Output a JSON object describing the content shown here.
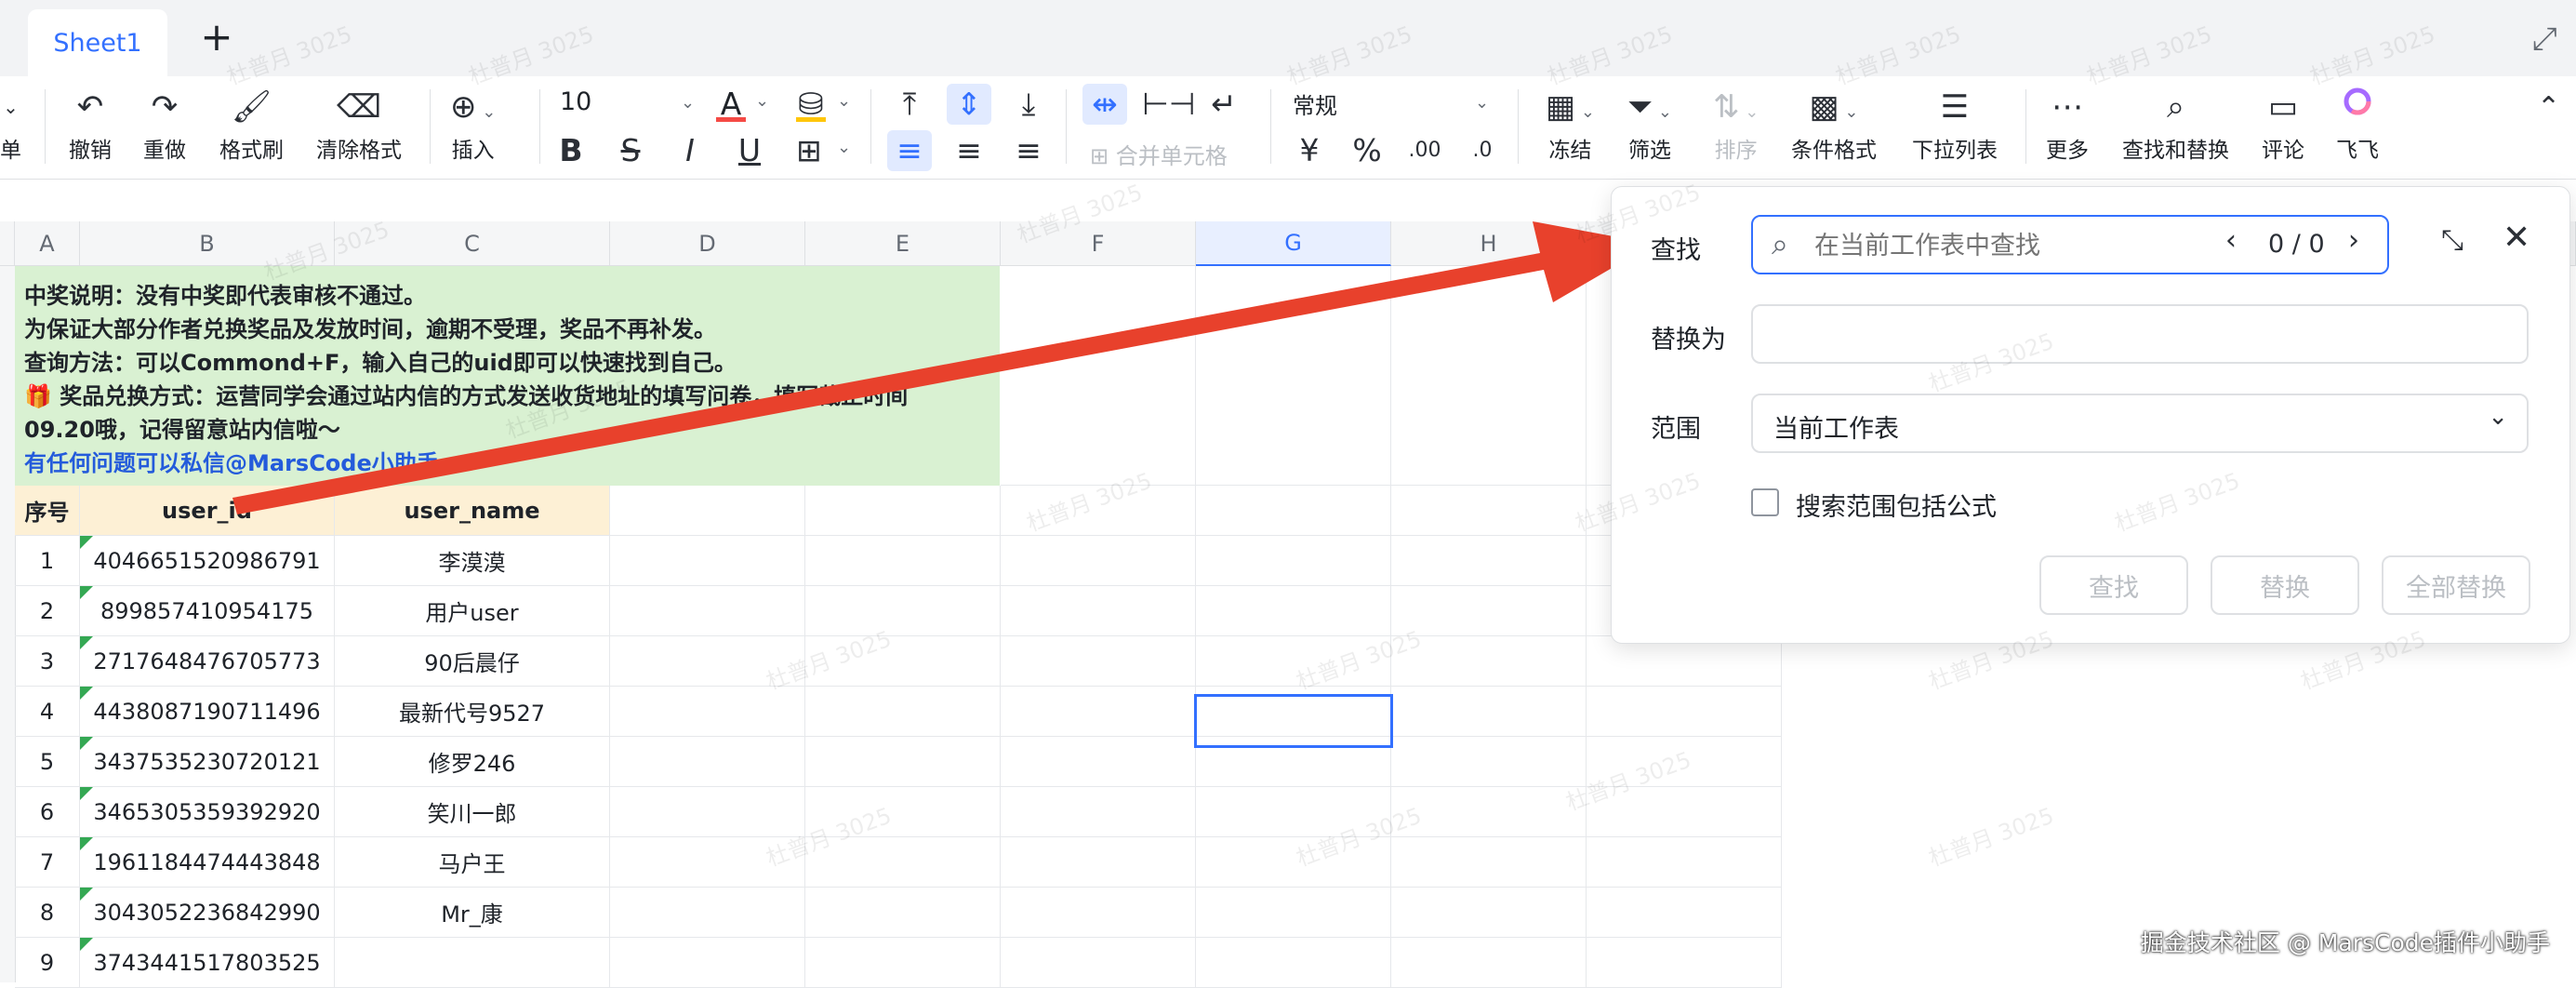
{
  "tabs": {
    "active_sheet": "Sheet1",
    "add_symbol": "+"
  },
  "toolbar": {
    "menu_fragment": "单",
    "undo": "撤销",
    "redo": "重做",
    "format_painter": "格式刷",
    "clear_format": "清除格式",
    "insert": "插入",
    "font_size": "10",
    "merge_cells": "合并单元格",
    "number_format": "常规",
    "freeze": "冻结",
    "filter": "筛选",
    "sort": "排序",
    "conditional_format": "条件格式",
    "dropdown_list": "下拉列表",
    "more": "更多",
    "find_replace": "查找和替换",
    "comment": "评论",
    "feifei": "飞飞",
    "bold_glyph": "B",
    "strike_glyph": "S",
    "italic_glyph": "I",
    "underline_glyph": "U",
    "currency_glyph": "¥",
    "percent_glyph": "%",
    "dec_inc_glyph": ".00",
    "dec_dec_glyph": ".0"
  },
  "columns": [
    "A",
    "B",
    "C",
    "D",
    "E",
    "F",
    "G",
    "H"
  ],
  "note": {
    "line1": "中奖说明：没有中奖即代表审核不通过。",
    "line2": "为保证大部分作者兑换奖品及发放时间，逾期不受理，奖品不再补发。",
    "line3": "查询方法：可以Commond+F，输入自己的uid即可以快速找到自己。",
    "line4": "🎁 奖品兑换方式：运营同学会通过站内信的方式发送收货地址的填写问卷，填写截止时间",
    "line5": "09.20哦，记得留意站内信啦～",
    "line6": "有任何问题可以私信@MarsCode小助手"
  },
  "table": {
    "headers": [
      "序号",
      "user_id",
      "user_name"
    ],
    "rows": [
      [
        "1",
        "4046651520986791",
        "李漠漠"
      ],
      [
        "2",
        "899857410954175",
        "用户user"
      ],
      [
        "3",
        "2717648476705773",
        "90后晨仔"
      ],
      [
        "4",
        "4438087190711496",
        "最新代号9527"
      ],
      [
        "5",
        "3437535230720121",
        "修罗246"
      ],
      [
        "6",
        "3465305359392920",
        "笑川一郎"
      ],
      [
        "7",
        "1961184474443848",
        "马户王"
      ],
      [
        "8",
        "3043052236842990",
        "Mr_康"
      ],
      [
        "9",
        "3743441517803525",
        ""
      ]
    ]
  },
  "find_panel": {
    "find_label": "查找",
    "find_placeholder": "在当前工作表中查找",
    "match_count": "0 / 0",
    "replace_label": "替换为",
    "replace_value": "",
    "scope_label": "范围",
    "scope_value": "当前工作表",
    "include_formula_label": "搜索范围包括公式",
    "include_formula_checked": false,
    "btn_find": "查找",
    "btn_replace": "替换",
    "btn_replace_all": "全部替换"
  },
  "watermark_text": "杜普月 3025",
  "credit": "掘金技术社区 @ MarsCode插件小助手",
  "colors": {
    "accent": "#3370ff",
    "note_bg": "#d9f1d2",
    "header_bg": "#fdf0d5",
    "arrow": "#e8412c"
  }
}
